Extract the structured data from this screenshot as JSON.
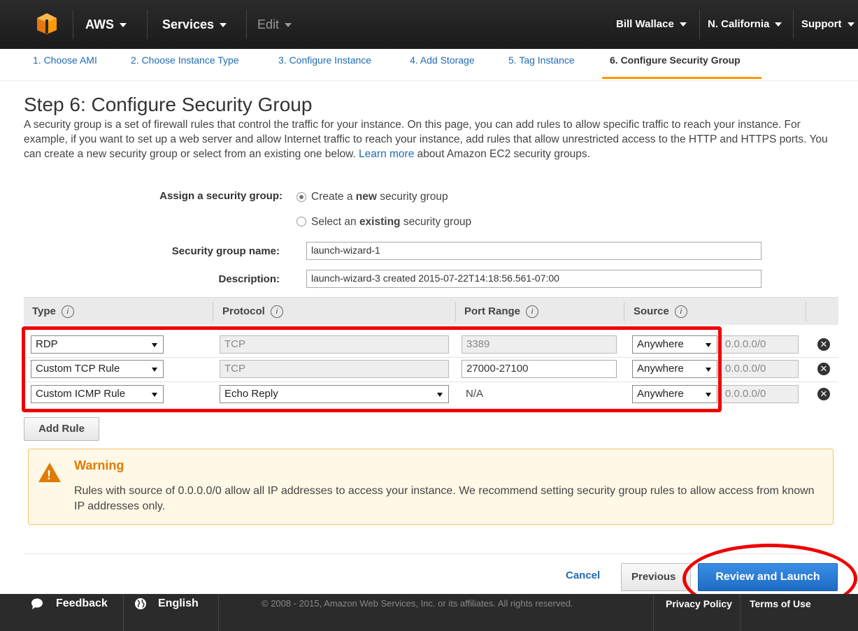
{
  "nav": {
    "aws": "AWS",
    "services": "Services",
    "edit": "Edit",
    "user": "Bill Wallace",
    "region": "N. California",
    "support": "Support"
  },
  "tabs": [
    {
      "label": "1. Choose AMI"
    },
    {
      "label": "2. Choose Instance Type"
    },
    {
      "label": "3. Configure Instance"
    },
    {
      "label": "4. Add Storage"
    },
    {
      "label": "5. Tag Instance"
    },
    {
      "label": "6. Configure Security Group"
    }
  ],
  "page": {
    "title": "Step 6: Configure Security Group",
    "intro_1": "A security group is a set of firewall rules that control the traffic for your instance. On this page, you can add rules to allow specific traffic to reach your instance. For example, if you want to set up a web server and allow Internet traffic to reach your instance, add rules that allow unrestricted access to the HTTP and HTTPS ports. You can create a new security group or select from an existing one below.",
    "learn_more": "Learn more",
    "intro_2": "about Amazon EC2 security groups."
  },
  "form": {
    "assign_label": "Assign a security group:",
    "opt_new_pre": "Create a ",
    "opt_new_bold": "new",
    "opt_new_post": " security group",
    "opt_existing_pre": "Select an ",
    "opt_existing_bold": "existing",
    "opt_existing_post": " security group",
    "name_label": "Security group name:",
    "name_value": "launch-wizard-1",
    "desc_label": "Description:",
    "desc_value": "launch-wizard-3 created 2015-07-22T14:18:56.561-07:00"
  },
  "table": {
    "headers": {
      "type": "Type",
      "protocol": "Protocol",
      "port": "Port Range",
      "source": "Source"
    },
    "info": "i",
    "rows": [
      {
        "type": "RDP",
        "protocol": "TCP",
        "port": "3389",
        "source": "Anywhere",
        "cidr": "0.0.0.0/0"
      },
      {
        "type": "Custom TCP Rule",
        "protocol": "TCP",
        "port": "27000-27100",
        "source": "Anywhere",
        "cidr": "0.0.0.0/0"
      },
      {
        "type": "Custom ICMP Rule",
        "protocol": "Echo Reply",
        "port": "N/A",
        "source": "Anywhere",
        "cidr": "0.0.0.0/0"
      }
    ],
    "remove_symbol": "✕",
    "add_rule": "Add Rule"
  },
  "warning": {
    "title": "Warning",
    "icon_text": "!",
    "text": "Rules with source of 0.0.0.0/0 allow all IP addresses to access your instance. We recommend setting security group rules to allow access from known IP addresses only."
  },
  "actions": {
    "cancel": "Cancel",
    "previous": "Previous",
    "review": "Review and Launch"
  },
  "footer": {
    "feedback": "Feedback",
    "english": "English",
    "copyright": "© 2008 - 2015, Amazon Web Services, Inc. or its affiliates. All rights reserved.",
    "privacy": "Privacy Policy",
    "terms": "Terms of Use"
  },
  "colors": {
    "accent": "#f90",
    "link": "#1f6bb4",
    "primary": "#1e6bc4",
    "warning": "#e07b00",
    "highlight": "#e00"
  }
}
